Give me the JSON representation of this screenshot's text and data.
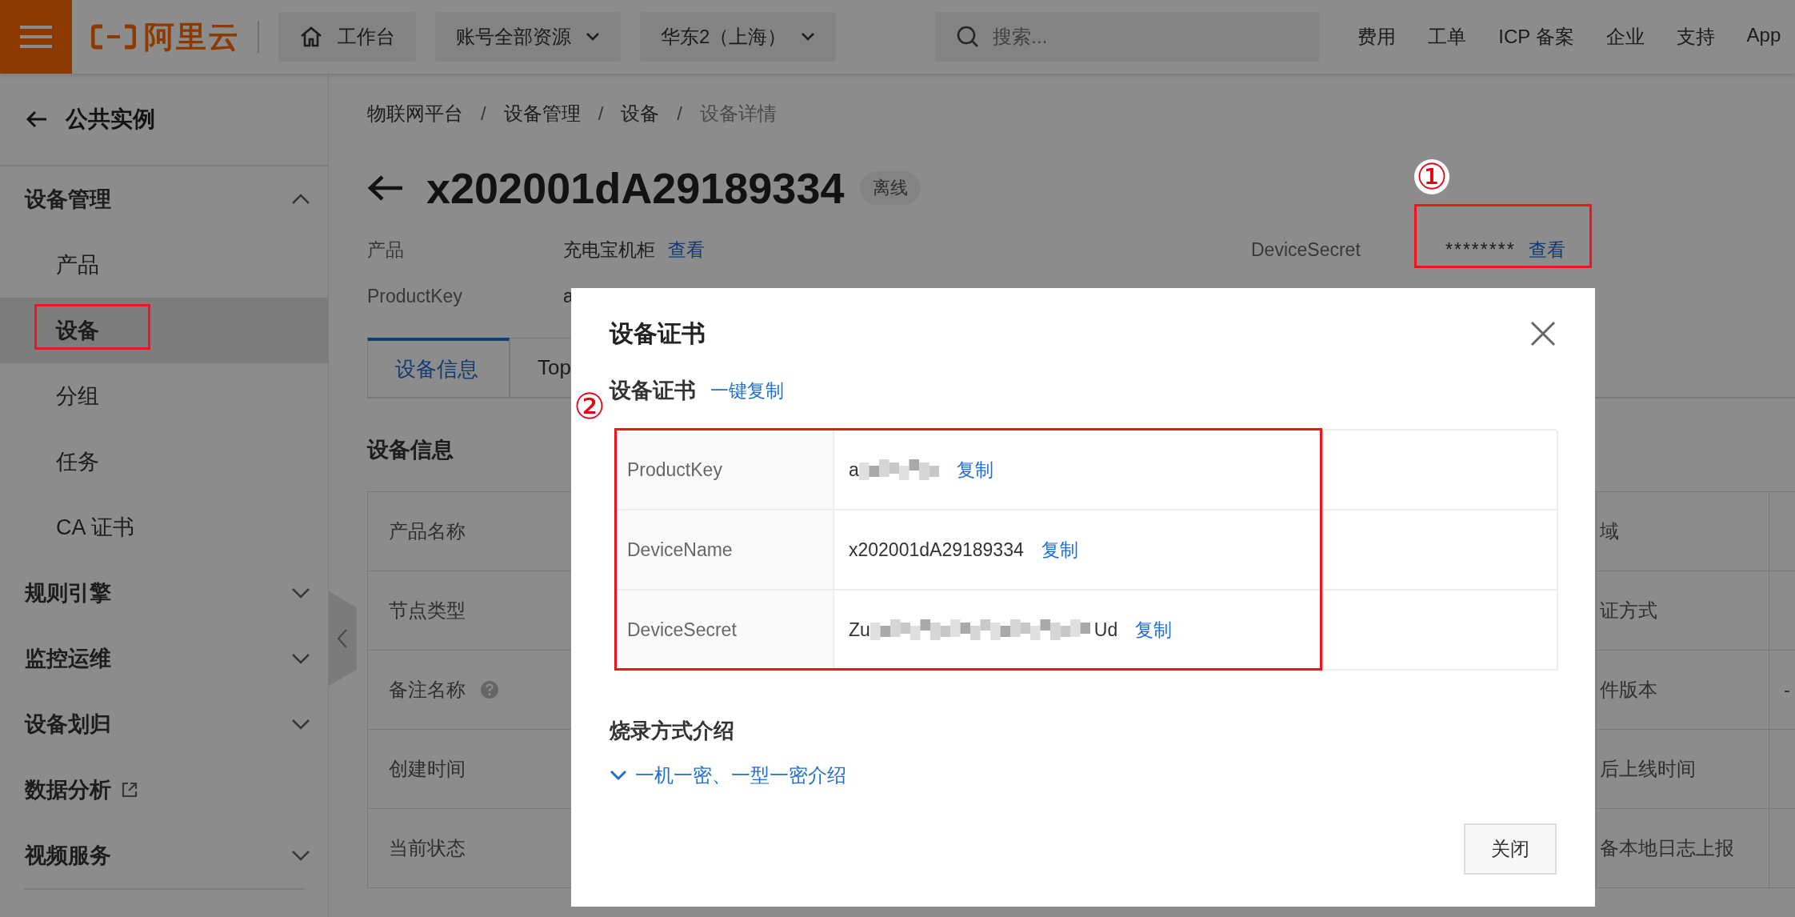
{
  "topbar": {
    "brand": "阿里云",
    "workbench": "工作台",
    "dropdowns": [
      "账号全部资源",
      "华东2（上海）"
    ],
    "search": {
      "placeholder": "搜索..."
    },
    "links": [
      "费用",
      "工单",
      "ICP 备案",
      "企业",
      "支持",
      "App"
    ]
  },
  "sidebar": {
    "back": "公共实例",
    "items": [
      {
        "kind": "group",
        "label": "设备管理",
        "expanded": true,
        "children": [
          {
            "label": "产品",
            "selected": false
          },
          {
            "label": "设备",
            "selected": true
          },
          {
            "label": "分组",
            "selected": false
          },
          {
            "label": "任务",
            "selected": false
          },
          {
            "label": "CA 证书",
            "selected": false
          }
        ]
      },
      {
        "kind": "group",
        "label": "规则引擎",
        "expanded": false
      },
      {
        "kind": "group",
        "label": "监控运维",
        "expanded": false
      },
      {
        "kind": "group",
        "label": "设备划归",
        "expanded": false
      },
      {
        "kind": "external",
        "label": "数据分析"
      },
      {
        "kind": "group",
        "label": "视频服务",
        "expanded": false
      }
    ]
  },
  "breadcrumb": [
    "物联网平台",
    "设备管理",
    "设备",
    "设备详情"
  ],
  "breadcrumb_separator": "/",
  "device": {
    "name": "x202001dA29189334",
    "status": "离线"
  },
  "info": [
    {
      "label": "产品",
      "value": "充电宝机柜",
      "link": "查看"
    },
    {
      "label": "ProductKey",
      "value": "a"
    }
  ],
  "secret": {
    "label": "DeviceSecret",
    "value": "********",
    "link": "查看"
  },
  "tabs": [
    {
      "label": "设备信息",
      "selected": true
    },
    {
      "label": "Top",
      "selected": false
    }
  ],
  "section_title": "设备信息",
  "info_table": [
    {
      "label": "产品名称",
      "help": false,
      "label_2": "域"
    },
    {
      "label": "节点类型",
      "help": false,
      "label_2": "证方式"
    },
    {
      "label": "备注名称",
      "help": true,
      "label_2": "件版本",
      "value_2": "-"
    },
    {
      "label": "创建时间",
      "help": false,
      "label_2": "后上线时间"
    },
    {
      "label": "当前状态",
      "help": false,
      "label_2": "备本地日志上报"
    }
  ],
  "dialog": {
    "title": "设备证书",
    "subtitle": "设备证书",
    "copy_all": "一键复制",
    "fields": [
      {
        "label": "ProductKey",
        "value": "a",
        "masked": true,
        "copy": "复制"
      },
      {
        "label": "DeviceName",
        "value": "x202001dA29189334",
        "masked": false,
        "copy": "复制"
      },
      {
        "label": "DeviceSecret",
        "value": "Zu",
        "masked": true,
        "value_end": "Ud",
        "copy": "复制"
      }
    ],
    "section": "烧录方式介绍",
    "expand_link": "一机一密、一型一密介绍",
    "close": "关闭"
  },
  "annotations": [
    "①",
    "②"
  ]
}
